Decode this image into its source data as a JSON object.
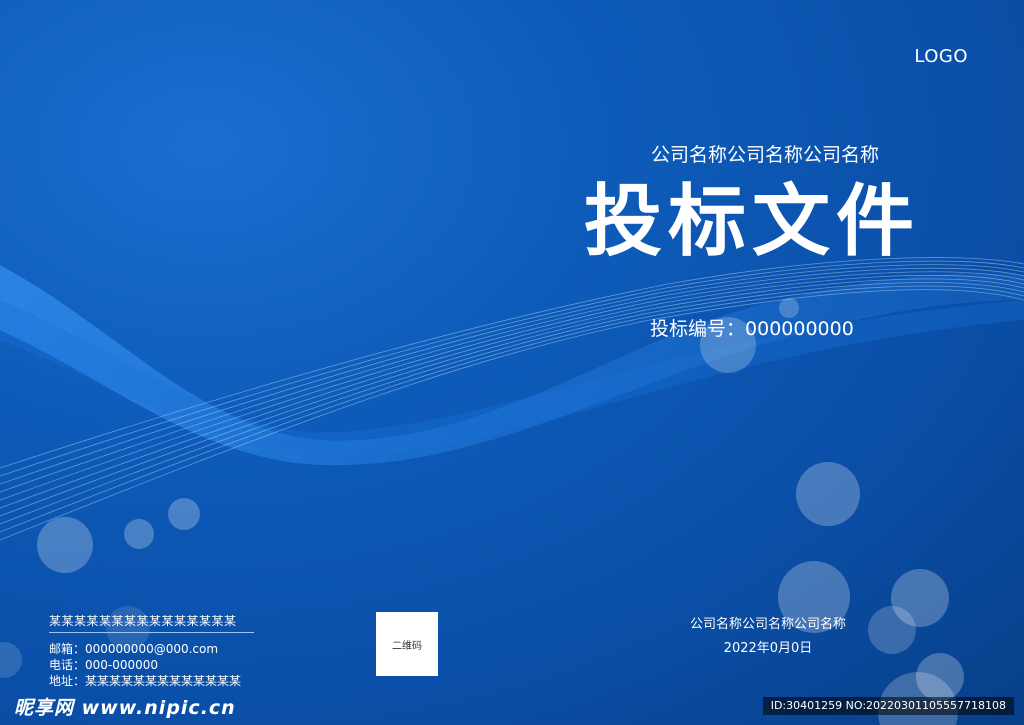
{
  "cover": {
    "logo": "LOGO",
    "company_top": "公司名称公司名称公司名称",
    "title": "投标文件",
    "bid_number_label": "投标编号：",
    "bid_number_value": "000000000"
  },
  "contact": {
    "name": "某某某某某某某某某某某某某某某",
    "email": "邮箱：000000000@000.com",
    "phone": "电话：000-000000",
    "address": "地址：某某某某某某某某某某某某某"
  },
  "qr_label": "二维码",
  "bottom": {
    "company": "公司名称公司名称公司名称",
    "date": "2022年0月0日"
  },
  "watermark": {
    "text": "昵享网 www.nipic.cn",
    "id": "ID:30401259 NO:20220301105557718108"
  },
  "colors": {
    "background": "#0d5bb9",
    "text": "#ffffff"
  }
}
